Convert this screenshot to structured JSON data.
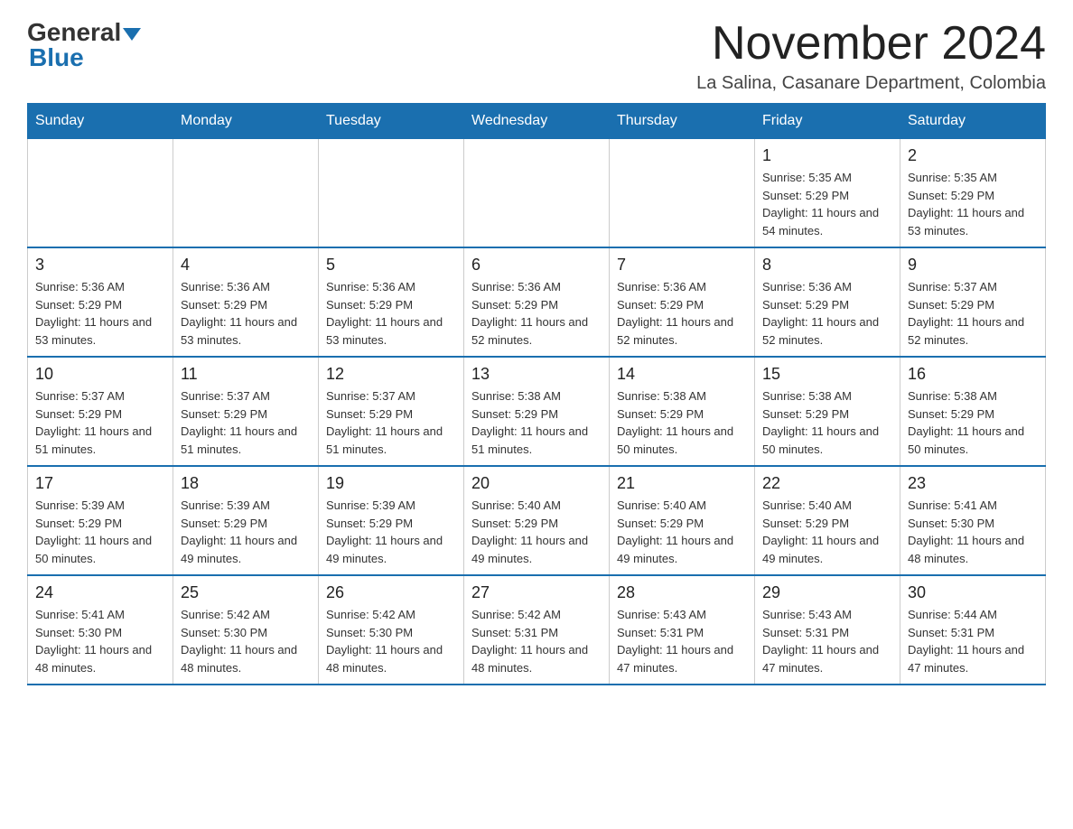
{
  "logo": {
    "general": "General",
    "blue": "Blue"
  },
  "title": "November 2024",
  "subtitle": "La Salina, Casanare Department, Colombia",
  "days_of_week": [
    "Sunday",
    "Monday",
    "Tuesday",
    "Wednesday",
    "Thursday",
    "Friday",
    "Saturday"
  ],
  "weeks": [
    [
      {
        "day": "",
        "sunrise": "",
        "sunset": "",
        "daylight": ""
      },
      {
        "day": "",
        "sunrise": "",
        "sunset": "",
        "daylight": ""
      },
      {
        "day": "",
        "sunrise": "",
        "sunset": "",
        "daylight": ""
      },
      {
        "day": "",
        "sunrise": "",
        "sunset": "",
        "daylight": ""
      },
      {
        "day": "",
        "sunrise": "",
        "sunset": "",
        "daylight": ""
      },
      {
        "day": "1",
        "sunrise": "Sunrise: 5:35 AM",
        "sunset": "Sunset: 5:29 PM",
        "daylight": "Daylight: 11 hours and 54 minutes."
      },
      {
        "day": "2",
        "sunrise": "Sunrise: 5:35 AM",
        "sunset": "Sunset: 5:29 PM",
        "daylight": "Daylight: 11 hours and 53 minutes."
      }
    ],
    [
      {
        "day": "3",
        "sunrise": "Sunrise: 5:36 AM",
        "sunset": "Sunset: 5:29 PM",
        "daylight": "Daylight: 11 hours and 53 minutes."
      },
      {
        "day": "4",
        "sunrise": "Sunrise: 5:36 AM",
        "sunset": "Sunset: 5:29 PM",
        "daylight": "Daylight: 11 hours and 53 minutes."
      },
      {
        "day": "5",
        "sunrise": "Sunrise: 5:36 AM",
        "sunset": "Sunset: 5:29 PM",
        "daylight": "Daylight: 11 hours and 53 minutes."
      },
      {
        "day": "6",
        "sunrise": "Sunrise: 5:36 AM",
        "sunset": "Sunset: 5:29 PM",
        "daylight": "Daylight: 11 hours and 52 minutes."
      },
      {
        "day": "7",
        "sunrise": "Sunrise: 5:36 AM",
        "sunset": "Sunset: 5:29 PM",
        "daylight": "Daylight: 11 hours and 52 minutes."
      },
      {
        "day": "8",
        "sunrise": "Sunrise: 5:36 AM",
        "sunset": "Sunset: 5:29 PM",
        "daylight": "Daylight: 11 hours and 52 minutes."
      },
      {
        "day": "9",
        "sunrise": "Sunrise: 5:37 AM",
        "sunset": "Sunset: 5:29 PM",
        "daylight": "Daylight: 11 hours and 52 minutes."
      }
    ],
    [
      {
        "day": "10",
        "sunrise": "Sunrise: 5:37 AM",
        "sunset": "Sunset: 5:29 PM",
        "daylight": "Daylight: 11 hours and 51 minutes."
      },
      {
        "day": "11",
        "sunrise": "Sunrise: 5:37 AM",
        "sunset": "Sunset: 5:29 PM",
        "daylight": "Daylight: 11 hours and 51 minutes."
      },
      {
        "day": "12",
        "sunrise": "Sunrise: 5:37 AM",
        "sunset": "Sunset: 5:29 PM",
        "daylight": "Daylight: 11 hours and 51 minutes."
      },
      {
        "day": "13",
        "sunrise": "Sunrise: 5:38 AM",
        "sunset": "Sunset: 5:29 PM",
        "daylight": "Daylight: 11 hours and 51 minutes."
      },
      {
        "day": "14",
        "sunrise": "Sunrise: 5:38 AM",
        "sunset": "Sunset: 5:29 PM",
        "daylight": "Daylight: 11 hours and 50 minutes."
      },
      {
        "day": "15",
        "sunrise": "Sunrise: 5:38 AM",
        "sunset": "Sunset: 5:29 PM",
        "daylight": "Daylight: 11 hours and 50 minutes."
      },
      {
        "day": "16",
        "sunrise": "Sunrise: 5:38 AM",
        "sunset": "Sunset: 5:29 PM",
        "daylight": "Daylight: 11 hours and 50 minutes."
      }
    ],
    [
      {
        "day": "17",
        "sunrise": "Sunrise: 5:39 AM",
        "sunset": "Sunset: 5:29 PM",
        "daylight": "Daylight: 11 hours and 50 minutes."
      },
      {
        "day": "18",
        "sunrise": "Sunrise: 5:39 AM",
        "sunset": "Sunset: 5:29 PM",
        "daylight": "Daylight: 11 hours and 49 minutes."
      },
      {
        "day": "19",
        "sunrise": "Sunrise: 5:39 AM",
        "sunset": "Sunset: 5:29 PM",
        "daylight": "Daylight: 11 hours and 49 minutes."
      },
      {
        "day": "20",
        "sunrise": "Sunrise: 5:40 AM",
        "sunset": "Sunset: 5:29 PM",
        "daylight": "Daylight: 11 hours and 49 minutes."
      },
      {
        "day": "21",
        "sunrise": "Sunrise: 5:40 AM",
        "sunset": "Sunset: 5:29 PM",
        "daylight": "Daylight: 11 hours and 49 minutes."
      },
      {
        "day": "22",
        "sunrise": "Sunrise: 5:40 AM",
        "sunset": "Sunset: 5:29 PM",
        "daylight": "Daylight: 11 hours and 49 minutes."
      },
      {
        "day": "23",
        "sunrise": "Sunrise: 5:41 AM",
        "sunset": "Sunset: 5:30 PM",
        "daylight": "Daylight: 11 hours and 48 minutes."
      }
    ],
    [
      {
        "day": "24",
        "sunrise": "Sunrise: 5:41 AM",
        "sunset": "Sunset: 5:30 PM",
        "daylight": "Daylight: 11 hours and 48 minutes."
      },
      {
        "day": "25",
        "sunrise": "Sunrise: 5:42 AM",
        "sunset": "Sunset: 5:30 PM",
        "daylight": "Daylight: 11 hours and 48 minutes."
      },
      {
        "day": "26",
        "sunrise": "Sunrise: 5:42 AM",
        "sunset": "Sunset: 5:30 PM",
        "daylight": "Daylight: 11 hours and 48 minutes."
      },
      {
        "day": "27",
        "sunrise": "Sunrise: 5:42 AM",
        "sunset": "Sunset: 5:31 PM",
        "daylight": "Daylight: 11 hours and 48 minutes."
      },
      {
        "day": "28",
        "sunrise": "Sunrise: 5:43 AM",
        "sunset": "Sunset: 5:31 PM",
        "daylight": "Daylight: 11 hours and 47 minutes."
      },
      {
        "day": "29",
        "sunrise": "Sunrise: 5:43 AM",
        "sunset": "Sunset: 5:31 PM",
        "daylight": "Daylight: 11 hours and 47 minutes."
      },
      {
        "day": "30",
        "sunrise": "Sunrise: 5:44 AM",
        "sunset": "Sunset: 5:31 PM",
        "daylight": "Daylight: 11 hours and 47 minutes."
      }
    ]
  ]
}
